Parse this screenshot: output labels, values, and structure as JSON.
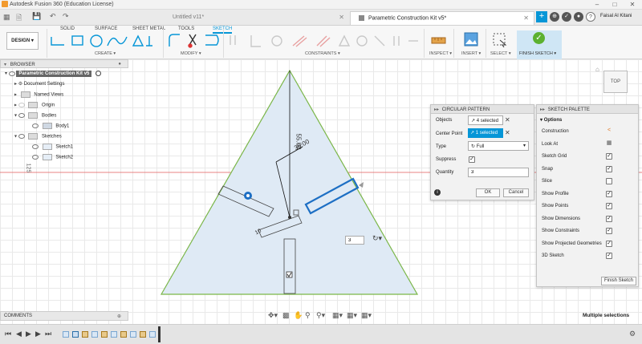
{
  "window": {
    "title": "Autodesk Fusion 360 (Education License)"
  },
  "tabs": {
    "items": [
      {
        "label": "Untitled v11*"
      },
      {
        "label": "Parametric Construction Kit v5*"
      }
    ],
    "user": "Faisal Al Kitani"
  },
  "ribbon": {
    "tabs": [
      "SOLID",
      "SURFACE",
      "SHEET METAL",
      "TOOLS",
      "SKETCH"
    ],
    "active_tab": "SKETCH",
    "workspace": "DESIGN ▾",
    "groups": [
      "CREATE ▾",
      "MODIFY ▾",
      "CONSTRAINTS ▾",
      "INSPECT ▾",
      "INSERT ▾",
      "SELECT ▾",
      "FINISH SKETCH ▾"
    ]
  },
  "browser": {
    "header": "BROWSER",
    "items": [
      {
        "label": "Parametric Construction Kit v5"
      },
      {
        "label": "Document Settings"
      },
      {
        "label": "Named Views"
      },
      {
        "label": "Origin"
      },
      {
        "label": "Bodies"
      },
      {
        "label": "Body1"
      },
      {
        "label": "Sketches"
      },
      {
        "label": "Sketch1"
      },
      {
        "label": "Sketch2"
      }
    ]
  },
  "canvas": {
    "dim_vertical": "55.00",
    "dim_angle": "30.00",
    "dim_small": "10",
    "side_label": "125",
    "qty_value": "3",
    "viewcube": "TOP"
  },
  "circular_pattern": {
    "title": "CIRCULAR PATTERN",
    "rows": {
      "objects_label": "Objects",
      "objects_value": "4 selected",
      "center_label": "Center Point",
      "center_value": "1 selected",
      "type_label": "Type",
      "type_value": "Full",
      "suppress_label": "Suppress",
      "quantity_label": "Quantity",
      "quantity_value": "3"
    },
    "ok": "OK",
    "cancel": "Cancel"
  },
  "sketch_palette": {
    "title": "SKETCH PALETTE",
    "section": "Options",
    "options": [
      {
        "label": "Construction",
        "checked": null
      },
      {
        "label": "Look At",
        "checked": null
      },
      {
        "label": "Sketch Grid",
        "checked": true
      },
      {
        "label": "Snap",
        "checked": true
      },
      {
        "label": "Slice",
        "checked": false
      },
      {
        "label": "Show Profile",
        "checked": true
      },
      {
        "label": "Show Points",
        "checked": true
      },
      {
        "label": "Show Dimensions",
        "checked": true
      },
      {
        "label": "Show Constraints",
        "checked": true
      },
      {
        "label": "Show Projected Geometries",
        "checked": true
      },
      {
        "label": "3D Sketch",
        "checked": true
      }
    ],
    "finish_button": "Finish Sketch"
  },
  "bottom": {
    "comments": "COMMENTS",
    "status": "Multiple selections"
  },
  "colors": {
    "accent": "#0696d7",
    "triangle_fill": "#dfeaf5",
    "triangle_edge": "#7ab648",
    "finish_green": "#5cb130",
    "axis_red": "#e25a5a"
  }
}
